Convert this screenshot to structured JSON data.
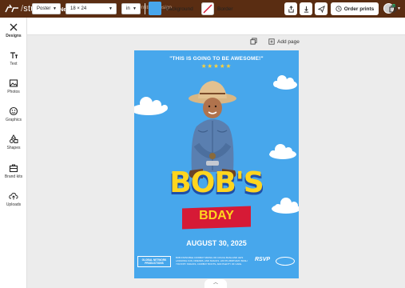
{
  "app": {
    "logo_text": "studio",
    "design_name": "New design",
    "design_title_placeholder": "Untitled design",
    "order_button": "Order prints"
  },
  "colors": {
    "topbar": "#5a2d12",
    "poster_bg": "#47a7ec",
    "accent_yellow": "#ffd51f",
    "accent_red": "#d61a36"
  },
  "sidebar": {
    "items": [
      {
        "label": "Designs",
        "icon": "designs-icon"
      },
      {
        "label": "Text",
        "icon": "text-icon"
      },
      {
        "label": "Photos",
        "icon": "photos-icon"
      },
      {
        "label": "Graphics",
        "icon": "graphics-icon"
      },
      {
        "label": "Shapes",
        "icon": "shapes-icon"
      },
      {
        "label": "Brand kits",
        "icon": "brand-kits-icon"
      },
      {
        "label": "Uploads",
        "icon": "uploads-icon"
      }
    ]
  },
  "options": {
    "product": "Poster",
    "size": "18 × 24",
    "unit": "in",
    "background_label": "Background",
    "border_label": "Border",
    "add_page": "Add page"
  },
  "poster": {
    "tagline": "\"THIS IS GOING TO BE AWESOME!\"",
    "stars": "★★★★★",
    "name": "BOB'S",
    "event": "BDAY",
    "date": "AUGUST 30, 2025",
    "footer_logo": "GLOBAL NETWORK PRODUCTIONS",
    "footer_text": "BOB INVINCIBLE COWBOY RIDING OR COUCH BASH AND HE'S LASSOING FUN, FRIENDS, AND SNACKS. HIS 5TH BIRTHDAY BASH YOU'R BY SNACKS, COWBOY BOOTS, AND PLENTY OF CAKE.",
    "rsvp": "RSVP"
  }
}
